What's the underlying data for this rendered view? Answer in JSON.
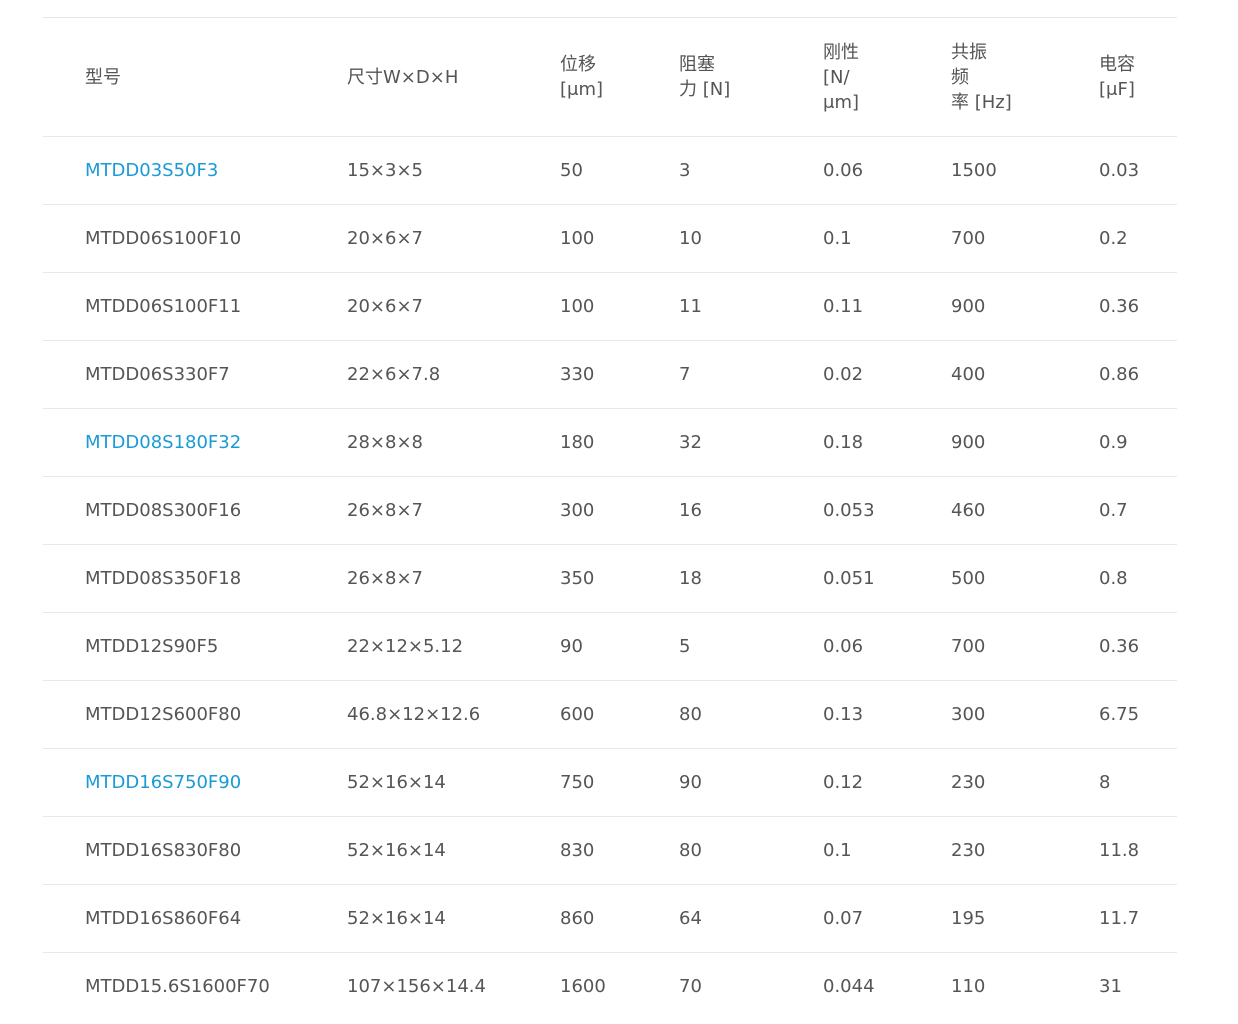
{
  "table": {
    "headers": [
      "型号",
      "尺寸W×D×H",
      "位移\n[μm]",
      "阻塞\n力 [N]",
      "刚性\n[N/\nμm]",
      "共振\n频\n率 [Hz]",
      "电容\n[μF]"
    ],
    "rows": [
      {
        "model": "MTDD03S50F3",
        "linked": true,
        "size": "15×3×5",
        "disp": "50",
        "force": "3",
        "stiff": "0.06",
        "freq": "1500",
        "cap": "0.03"
      },
      {
        "model": "MTDD06S100F10",
        "linked": false,
        "size": "20×6×7",
        "disp": "100",
        "force": "10",
        "stiff": "0.1",
        "freq": "700",
        "cap": "0.2"
      },
      {
        "model": "MTDD06S100F11",
        "linked": false,
        "size": "20×6×7",
        "disp": "100",
        "force": "11",
        "stiff": "0.11",
        "freq": "900",
        "cap": "0.36"
      },
      {
        "model": "MTDD06S330F7",
        "linked": false,
        "size": "22×6×7.8",
        "disp": "330",
        "force": "7",
        "stiff": "0.02",
        "freq": "400",
        "cap": "0.86"
      },
      {
        "model": "MTDD08S180F32",
        "linked": true,
        "size": "28×8×8",
        "disp": "180",
        "force": "32",
        "stiff": "0.18",
        "freq": "900",
        "cap": "0.9"
      },
      {
        "model": "MTDD08S300F16",
        "linked": false,
        "size": "26×8×7",
        "disp": "300",
        "force": "16",
        "stiff": "0.053",
        "freq": "460",
        "cap": "0.7"
      },
      {
        "model": "MTDD08S350F18",
        "linked": false,
        "size": "26×8×7",
        "disp": "350",
        "force": "18",
        "stiff": "0.051",
        "freq": "500",
        "cap": "0.8"
      },
      {
        "model": "MTDD12S90F5",
        "linked": false,
        "size": "22×12×5.12",
        "disp": "90",
        "force": "5",
        "stiff": "0.06",
        "freq": "700",
        "cap": "0.36"
      },
      {
        "model": "MTDD12S600F80",
        "linked": false,
        "size": "46.8×12×12.6",
        "disp": "600",
        "force": "80",
        "stiff": "0.13",
        "freq": "300",
        "cap": "6.75"
      },
      {
        "model": "MTDD16S750F90",
        "linked": true,
        "size": "52×16×14",
        "disp": "750",
        "force": "90",
        "stiff": "0.12",
        "freq": "230",
        "cap": "8"
      },
      {
        "model": "MTDD16S830F80",
        "linked": false,
        "size": "52×16×14",
        "disp": "830",
        "force": "80",
        "stiff": "0.1",
        "freq": "230",
        "cap": "11.8"
      },
      {
        "model": "MTDD16S860F64",
        "linked": false,
        "size": "52×16×14",
        "disp": "860",
        "force": "64",
        "stiff": "0.07",
        "freq": "195",
        "cap": "11.7"
      },
      {
        "model": "MTDD15.6S1600F70",
        "linked": false,
        "size": "107×156×14.4",
        "disp": "1600",
        "force": "70",
        "stiff": "0.044",
        "freq": "110",
        "cap": "31"
      }
    ]
  },
  "colors": {
    "link": "#1a9ad6",
    "text": "#555555",
    "divider": "#e8e8e8"
  }
}
